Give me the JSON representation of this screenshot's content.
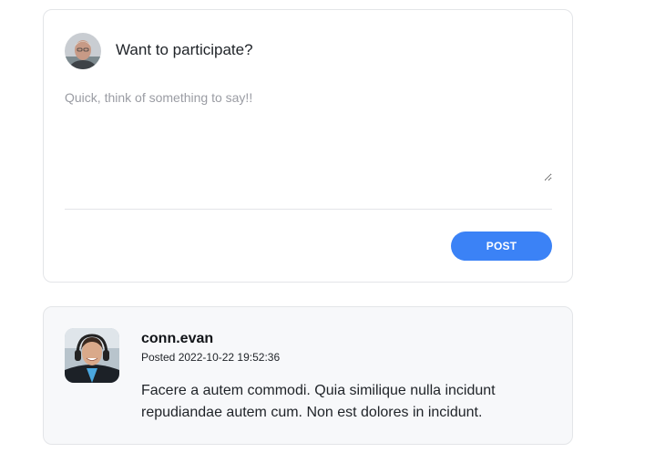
{
  "composer": {
    "title": "Want to participate?",
    "placeholder": "Quick, think of something to say!!",
    "value": "",
    "post_label": "POST",
    "accent_color": "#3b82f6"
  },
  "comments": [
    {
      "author": "conn.evan",
      "posted_prefix": "Posted",
      "timestamp": "2022-10-22 19:52:36",
      "body": "Facere a autem commodi. Quia similique nulla incidunt repudiandae autem cum. Non est dolores in incidunt."
    }
  ]
}
